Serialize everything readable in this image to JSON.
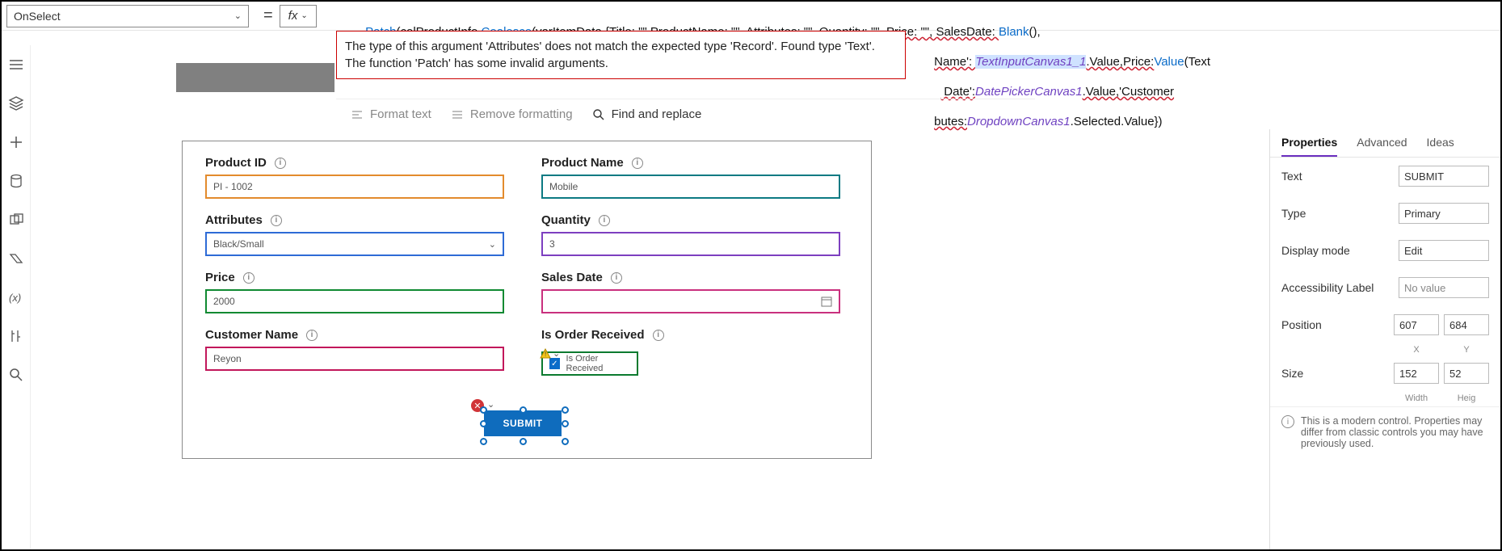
{
  "topbar": {
    "property": "OnSelect",
    "fx_label": "fx"
  },
  "formula": {
    "line1_a": "Patch",
    "line1_b": "(colProductInfo,",
    "line1_c": "Coalesce",
    "line1_d": "(varItemData,{Title: \"\",ProductName: \"\", Attributes: \"\", Quantity: \"\", Price: \"\", SalesDate: ",
    "line1_e": "Blank",
    "line1_f": "(),",
    "line2_a": "Name': ",
    "line2_b": "TextInputCanvas1_1",
    "line2_c": ".Value,Price:",
    "line2_d": "Value",
    "line2_e": "(Text",
    "line3_a": " Date':",
    "line3_b": "DatePickerCanvas1",
    "line3_c": ".Value,'Customer",
    "line4_a": "butes:",
    "line4_b": "DropdownCanvas1",
    "line4_c": ".Selected.Value})"
  },
  "error": {
    "line1": "The type of this argument 'Attributes' does not match the expected type 'Record'. Found type 'Text'.",
    "line2": "The function 'Patch' has some invalid arguments."
  },
  "fb_toolbar": {
    "format": "Format text",
    "remove": "Remove formatting",
    "find": "Find and replace"
  },
  "form": {
    "product_id_label": "Product ID",
    "product_id_value": "PI - 1002",
    "product_name_label": "Product Name",
    "product_name_value": "Mobile",
    "attributes_label": "Attributes",
    "attributes_value": "Black/Small",
    "quantity_label": "Quantity",
    "quantity_value": "3",
    "price_label": "Price",
    "price_value": "2000",
    "sales_date_label": "Sales Date",
    "sales_date_value": "",
    "customer_name_label": "Customer Name",
    "customer_name_value": "Reyon",
    "is_order_label": "Is Order Received",
    "is_order_check": "Is Order Received",
    "submit": "SUBMIT"
  },
  "props": {
    "tabs": {
      "properties": "Properties",
      "advanced": "Advanced",
      "ideas": "Ideas"
    },
    "text_label": "Text",
    "text_value": "SUBMIT",
    "type_label": "Type",
    "type_value": "Primary",
    "display_label": "Display mode",
    "display_value": "Edit",
    "access_label": "Accessibility Label",
    "access_value": "No value",
    "position_label": "Position",
    "position_x": "607",
    "position_y": "684",
    "pos_xl": "X",
    "pos_yl": "Y",
    "size_label": "Size",
    "size_w": "152",
    "size_h": "52",
    "size_wl": "Width",
    "size_hl": "Heig",
    "note": "This is a modern control. Properties may differ from classic controls you may have previously used."
  }
}
